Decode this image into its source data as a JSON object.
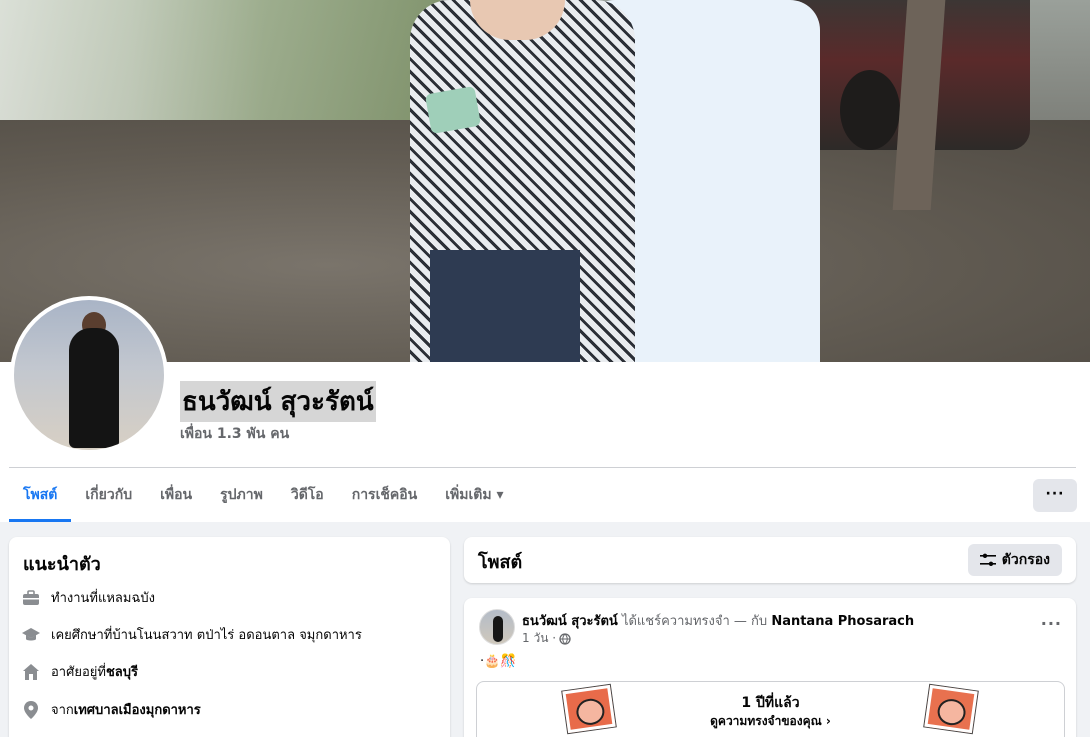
{
  "profile": {
    "name": "ธนวัฒน์ สุวะรัตน์",
    "friends": "เพื่อน 1.3 พัน คน"
  },
  "tabs": [
    {
      "label": "โพสต์",
      "active": true
    },
    {
      "label": "เกี่ยวกับ"
    },
    {
      "label": "เพื่อน"
    },
    {
      "label": "รูปภาพ"
    },
    {
      "label": "วิดีโอ"
    },
    {
      "label": "การเช็คอิน"
    },
    {
      "label": "เพิ่มเติม ▾"
    }
  ],
  "more_button": "···",
  "intro": {
    "title": "แนะนำตัว",
    "work_prefix": "ทำงานที่ ",
    "work_value": "แหลมฉบัง",
    "study_prefix": "เคยศึกษาที่ ",
    "study_value": "บ้านโนนสวาท ตป่าไร่ อดอนตาล จมุกดาหาร",
    "live_prefix": "อาศัยอยู่ที่ ",
    "live_value": "ชลบุรี",
    "from_prefix": "จาก ",
    "from_value": "เทศบาลเมืองมุกดาหาร"
  },
  "posts_header": {
    "title": "โพสต์",
    "filter_label": "ตัวกรอง"
  },
  "post": {
    "author": "ธนวัฒน์ สุวะรัตน์",
    "action": " ได้แชร์ความทรงจำ — กับ ",
    "tagged": "Nantana Phosarach",
    "time": "1 วัน ·",
    "emoji": "·🎂🎊",
    "menu": "···",
    "memory_title": "1 ปีที่แล้ว",
    "memory_sub": "ดูความทรงจำของคุณ ›"
  },
  "colors": {
    "accent": "#1877f2",
    "secondary_text": "#65676b",
    "button_bg": "#e4e6eb"
  }
}
